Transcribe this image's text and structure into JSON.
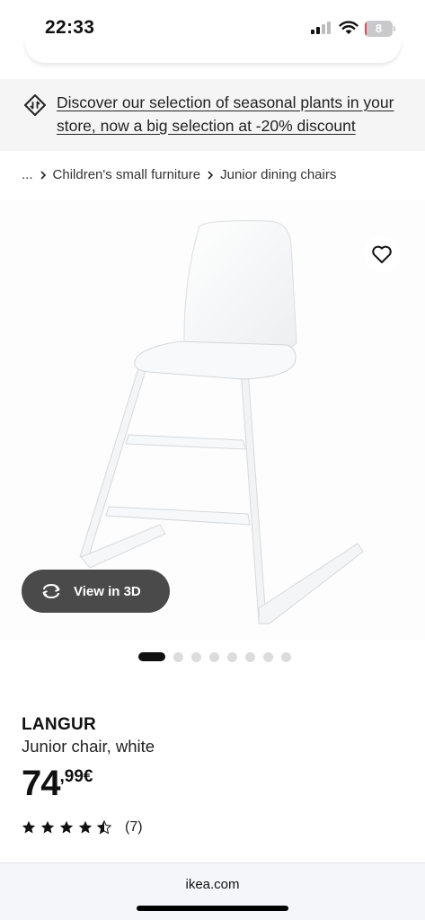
{
  "status_bar": {
    "time": "22:33",
    "battery_level": "8"
  },
  "banner": {
    "text": "Discover our selection of seasonal plants in your store, now a big selection at -20% discount"
  },
  "breadcrumb": {
    "ellipsis": "...",
    "items": [
      "Children's small furniture",
      "Junior dining chairs"
    ]
  },
  "gallery": {
    "view_3d_label": "View in 3D",
    "image_count": 8,
    "active_index": 0
  },
  "product": {
    "name": "LANGUR",
    "description": "Junior chair, white",
    "price_integer": "74",
    "price_decimal": ",99€",
    "rating": 4.5,
    "review_count": "(7)"
  },
  "browser": {
    "url": "ikea.com"
  },
  "colors": {
    "battery_low": "#e5484d",
    "banner_bg": "#f5f5f5",
    "pill_bg": "#4a4a4a",
    "url_bar_bg": "#f4f6f9"
  },
  "icons": [
    "cellular-signal-icon",
    "wifi-icon",
    "battery-icon",
    "tag-icon",
    "chevron-right-icon",
    "heart-icon",
    "rotate-3d-icon",
    "star-icon"
  ]
}
